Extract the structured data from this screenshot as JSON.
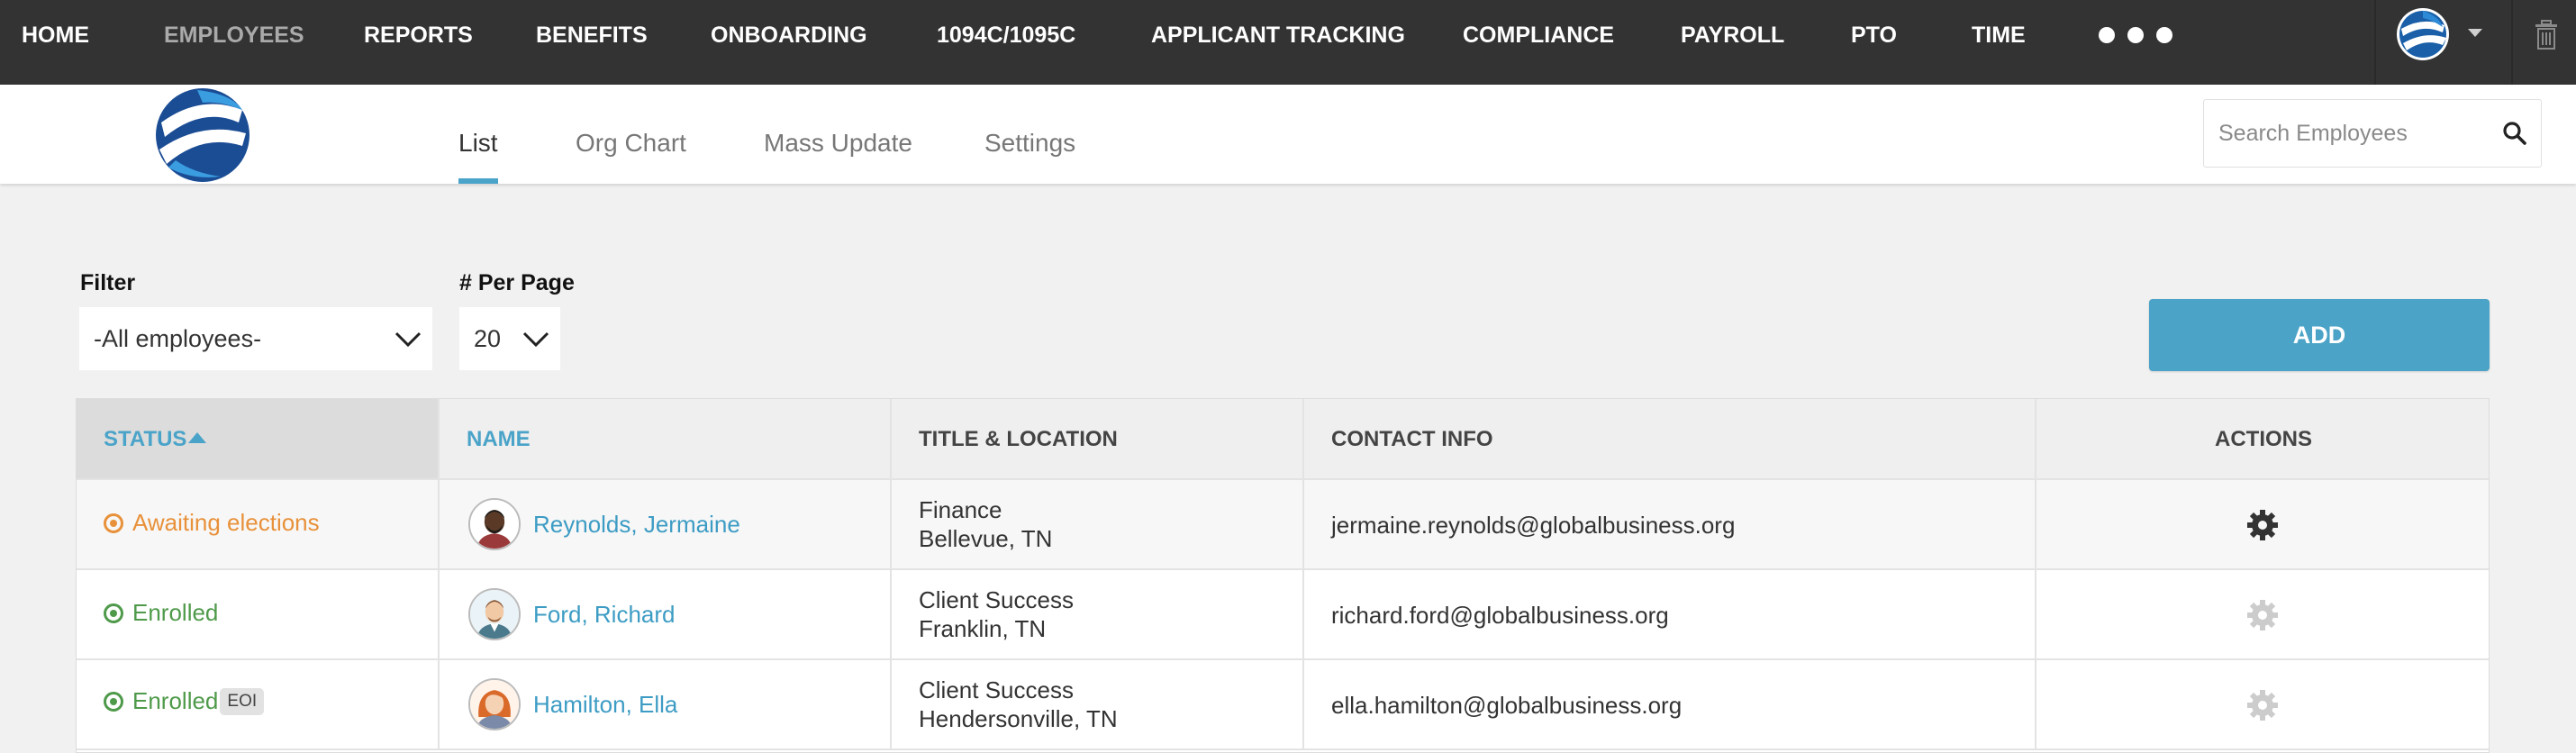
{
  "nav": {
    "items": [
      "HOME",
      "EMPLOYEES",
      "REPORTS",
      "BENEFITS",
      "ONBOARDING",
      "1094C/1095C",
      "APPLICANT TRACKING",
      "COMPLIANCE",
      "PAYROLL",
      "PTO",
      "TIME"
    ],
    "active": "EMPLOYEES",
    "more_icon": "ellipsis-icon",
    "account_icon": "globe-avatar-icon",
    "trash_icon": "trash-icon"
  },
  "subnav": {
    "tabs": [
      "List",
      "Org Chart",
      "Mass Update",
      "Settings"
    ],
    "active": "List"
  },
  "search": {
    "placeholder": "Search Employees",
    "value": ""
  },
  "filters": {
    "filter_label": "Filter",
    "filter_value": "-All employees-",
    "per_page_label": "# Per Page",
    "per_page_value": "20"
  },
  "add_button": "ADD",
  "table": {
    "headers": {
      "status": "STATUS",
      "name": "NAME",
      "title_location": "TITLE & LOCATION",
      "contact": "CONTACT INFO",
      "actions": "ACTIONS"
    },
    "rows": [
      {
        "status": "Awaiting elections",
        "status_color": "#e8913a",
        "badge": "",
        "name": "Reynolds, Jermaine",
        "title": "Finance",
        "location": "Bellevue, TN",
        "email": "jermaine.reynolds@globalbusiness.org",
        "gear_color": "#333333"
      },
      {
        "status": "Enrolled",
        "status_color": "#4f9a4a",
        "badge": "",
        "name": "Ford, Richard",
        "title": "Client Success",
        "location": "Franklin, TN",
        "email": "richard.ford@globalbusiness.org",
        "gear_color": "#cccccc"
      },
      {
        "status": "Enrolled",
        "status_color": "#4f9a4a",
        "badge": "EOI",
        "name": "Hamilton, Ella",
        "title": "Client Success",
        "location": "Hendersonville, TN",
        "email": "ella.hamilton@globalbusiness.org",
        "gear_color": "#cccccc"
      }
    ]
  },
  "colors": {
    "accent": "#4aa3c8",
    "nav_bg": "#333333"
  }
}
